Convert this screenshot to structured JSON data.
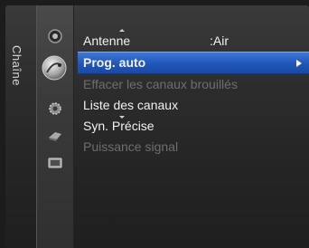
{
  "sidebar": {
    "title": "Chaîne",
    "icons": [
      "picture-icon",
      "channel-icon",
      "setup-icon",
      "input-icon",
      "application-icon"
    ],
    "active_index": 1
  },
  "menu": {
    "items": [
      {
        "label": "Antenne",
        "value": ":Air",
        "state": "normal"
      },
      {
        "label": "Prog. auto",
        "value": "",
        "state": "selected"
      },
      {
        "label": "Effacer les canaux brouillés",
        "value": "",
        "state": "disabled"
      },
      {
        "label": "Liste des canaux",
        "value": "",
        "state": "normal"
      },
      {
        "label": "Syn. Précise",
        "value": "",
        "state": "normal"
      },
      {
        "label": "Puissance signal",
        "value": "",
        "state": "disabled"
      }
    ]
  },
  "colors": {
    "selection": "#2a62c6",
    "text": "#f2f2f2",
    "disabled_text": "#6e6e6e",
    "background": "#2c2c2c"
  }
}
